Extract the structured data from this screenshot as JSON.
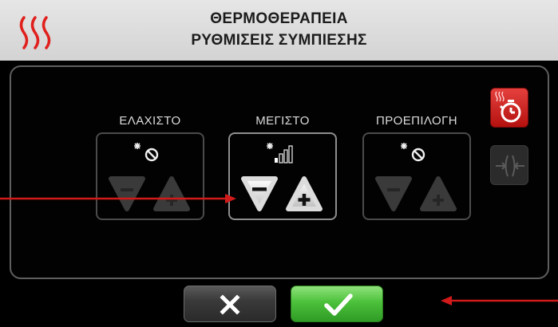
{
  "header": {
    "title_line1": "ΘΕΡΜΟΘΕΡΑΠΕΙΑ",
    "title_line2": "ΡΥΘΜΙΣΕΙΣ ΣΥΜΠΙΕΣΗΣ",
    "icon": "heat-waves-icon",
    "accent_color": "#e0201c"
  },
  "settings": {
    "min": {
      "label": "ΕΛΑΧΙΣΤΟ",
      "status_icon": "compression-off-icon",
      "enabled": false
    },
    "max": {
      "label": "ΜΕΓΙΣΤΟ",
      "status_icon": "compression-level-icon",
      "enabled": true,
      "level_bars": 4,
      "level_bars_active": 1
    },
    "preset": {
      "label": "ΠΡΟΕΠΙΛΟΓΗ",
      "status_icon": "compression-off-icon",
      "enabled": false
    }
  },
  "side_buttons": [
    {
      "name": "heat-timer",
      "icon": "heat-timer-icon",
      "enabled": true,
      "color": "#d42220"
    },
    {
      "name": "release-compression",
      "icon": "release-compression-icon",
      "enabled": false
    }
  ],
  "footer": {
    "cancel_icon": "close-icon",
    "confirm_icon": "check-icon",
    "confirm_color": "#4cc13b"
  },
  "annotations": {
    "arrow_color": "#d11a1a"
  }
}
